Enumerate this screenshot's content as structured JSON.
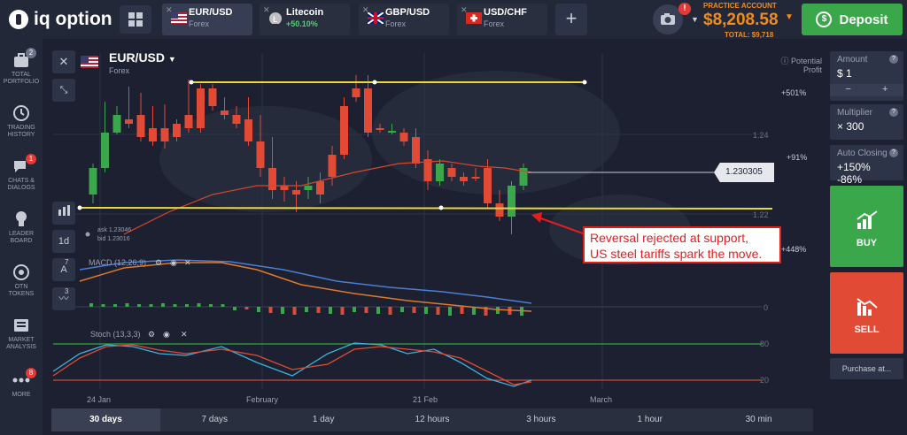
{
  "brand": {
    "name": "iq option"
  },
  "tabs": [
    {
      "name": "EUR/USD",
      "sub": "Forex",
      "active": true
    },
    {
      "name": "Litecoin",
      "sub": "+50.10%",
      "active": false
    },
    {
      "name": "GBP/USD",
      "sub": "Forex",
      "active": false
    },
    {
      "name": "USD/CHF",
      "sub": "Forex",
      "active": false
    }
  ],
  "account": {
    "type": "PRACTICE ACCOUNT",
    "balance": "$8,208.58",
    "total": "TOTAL: $9,718",
    "notification_count": "!"
  },
  "deposit_label": "Deposit",
  "sidebar": [
    {
      "label1": "TOTAL",
      "label2": "PORTFOLIO",
      "badge": "2"
    },
    {
      "label1": "TRADING",
      "label2": "HISTORY",
      "badge": ""
    },
    {
      "label1": "CHATS &",
      "label2": "DIALOGS",
      "badge": "1"
    },
    {
      "label1": "LEADER",
      "label2": "BOARD",
      "badge": ""
    },
    {
      "label1": "OTN",
      "label2": "TOKENS",
      "badge": ""
    },
    {
      "label1": "MARKET",
      "label2": "ANALYSIS",
      "badge": ""
    },
    {
      "label1": "MORE",
      "label2": "",
      "badge": "8"
    }
  ],
  "chart": {
    "pair": "EUR/USD",
    "market": "Forex",
    "ask": "ask 1.23046",
    "bid": "bid 1.23016",
    "timeframe": "1d",
    "current_price": "1.230305",
    "potential_profit_label": "Potential Profit",
    "price_labels": [
      "1.24",
      "1.22"
    ],
    "profit_labels": [
      "+501%",
      "+91%",
      "+448%"
    ],
    "macd_label": "MACD (12,26,9)",
    "macd_zero": "0",
    "stoch_label": "Stoch (13,3,3)",
    "stoch_levels": [
      "80",
      "20"
    ],
    "date_labels": [
      "24 Jan",
      "February",
      "21 Feb",
      "March"
    ],
    "tool_counts": [
      "7",
      "3"
    ]
  },
  "annotation": {
    "line1": "Reversal rejected at support,",
    "line2": "US steel tariffs spark the move."
  },
  "timeframes": [
    "30 days",
    "7 days",
    "1 day",
    "12 hours",
    "3 hours",
    "1 hour",
    "30 min"
  ],
  "right_panel": {
    "amount_label": "Amount",
    "amount_value": "$ 1",
    "multiplier_label": "Multiplier",
    "multiplier_value": "× 300",
    "auto_label": "Auto Closing",
    "auto_value": "+150% -86%",
    "buy_label": "BUY",
    "sell_label": "SELL",
    "purchase_label": "Purchase at..."
  },
  "colors": {
    "up": "#3aa84a",
    "down": "#e14b35",
    "support": "#e8d83c",
    "macd": "#4a7fd4",
    "signal": "#e07a2a"
  }
}
